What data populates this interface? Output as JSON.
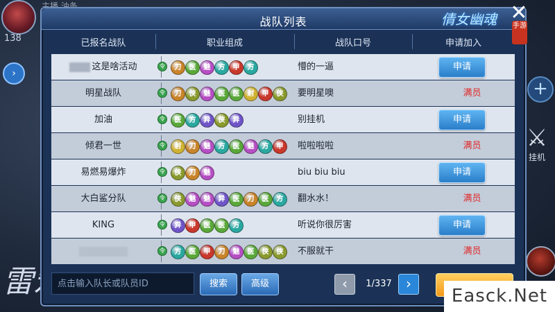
{
  "background": {
    "top_text": "主播 油条",
    "left_number": "138",
    "right_label": "挂机",
    "calligraphy": "雷宏"
  },
  "panel": {
    "title": "战队列表",
    "logo": "倩女幽魂",
    "logo_sub": "手游"
  },
  "headers": {
    "team": "已报名战队",
    "classes": "职业组成",
    "slogan": "战队口号",
    "apply": "申请加入"
  },
  "rows": [
    {
      "name": "这是啥活动",
      "name_blurred": true,
      "classes": [
        "刀",
        "医",
        "魅",
        "方",
        "甲",
        "方"
      ],
      "slogan": "懵的一逼",
      "action": "申请",
      "full": false
    },
    {
      "name": "明星战队",
      "classes": [
        "刀",
        "侠",
        "魅",
        "医",
        "医",
        "射",
        "甲",
        "侠"
      ],
      "slogan": "要明星噢",
      "action": "满员",
      "full": true
    },
    {
      "name": "加油",
      "classes": [
        "医",
        "方",
        "异",
        "侠",
        "异"
      ],
      "slogan": "别挂机",
      "action": "申请",
      "full": false
    },
    {
      "name": "倾君一世",
      "classes": [
        "射",
        "刀",
        "魅",
        "方",
        "医",
        "魅",
        "方",
        "甲"
      ],
      "slogan": "啦啦啦啦",
      "action": "满员",
      "full": true
    },
    {
      "name": "易燃易爆炸",
      "classes": [
        "侠",
        "刀",
        "魅"
      ],
      "slogan": "biu biu biu",
      "action": "申请",
      "full": false
    },
    {
      "name": "大白鲨分队",
      "classes": [
        "侠",
        "魅",
        "魅",
        "异",
        "医",
        "刀",
        "医",
        "方"
      ],
      "slogan": "翻水水！",
      "action": "满员",
      "full": true
    },
    {
      "name": "KING",
      "classes": [
        "异",
        "甲",
        "医",
        "医",
        "方"
      ],
      "slogan": "听说你很厉害",
      "action": "申请",
      "full": false
    },
    {
      "name": "",
      "name_blurred": true,
      "classes": [
        "方",
        "医",
        "甲",
        "刀",
        "魅",
        "医",
        "侠",
        "侠"
      ],
      "slogan": "不服就干",
      "action": "满员",
      "full": true
    }
  ],
  "class_colors": {
    "刀": "#c9842a",
    "医": "#5aa83a",
    "魅": "#b64fc4",
    "方": "#2aa8a0",
    "甲": "#c9382c",
    "侠": "#8a9a2e",
    "射": "#d0b233",
    "异": "#6f55c8"
  },
  "footer": {
    "search_placeholder": "点击输入队长或队员ID",
    "search_label": "搜索",
    "advanced_label": "高级",
    "prev_icon": "‹",
    "next_icon": "›",
    "page": "1/337"
  },
  "watermark": "Easck.Net"
}
